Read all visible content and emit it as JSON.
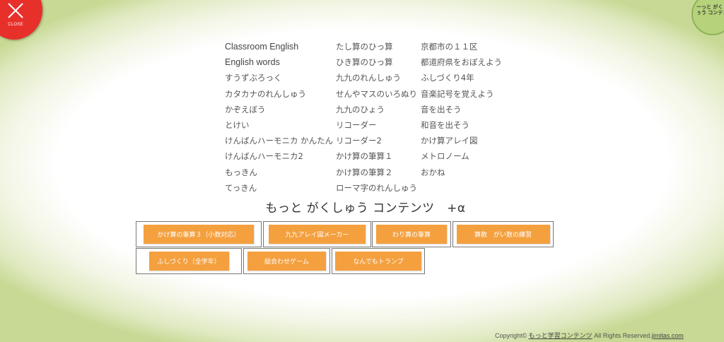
{
  "close": {
    "label": "CLOSE"
  },
  "logo": {
    "text": "ーっと がく　ぅう コンテン"
  },
  "links": {
    "col1": [
      "Classroom English",
      "English words",
      "すうずぶろっく",
      "カタカナのれんしゅう",
      "かぞえぼう",
      "とけい",
      "けんばんハーモニカ かんたん",
      "けんばんハーモニカ2",
      "もっきん",
      "てっきん"
    ],
    "col2": [
      "たし算のひっ算",
      "ひき算のひっ算",
      "九九のれんしゅう",
      "せんやマスのいろぬり",
      "九九のひょう",
      "リコーダー",
      "リコーダー2",
      "かけ算の筆算１",
      "かけ算の筆算２",
      "ローマ字のれんしゅう"
    ],
    "col3": [
      "京都市の１１区",
      "都道府県をおぼえよう",
      "ふしづくり4年",
      "音楽記号を覚えよう",
      "音を出そう",
      "和音を出そう",
      "かけ算アレイ図",
      "メトロノーム",
      "おかね"
    ]
  },
  "heading": "もっと がくしゅう コンテンツ　+α",
  "tools": {
    "row1": [
      "かけ算の筆算３（小数対応）",
      "九九アレイ図メーカー",
      "わり算の筆算",
      "算数　がい数の練習"
    ],
    "row2": [
      "ふしづくり（全学年）",
      "総合わせゲーム",
      "なんでもトランプ"
    ]
  },
  "footer": {
    "prefix": "Copyright©",
    "link": "もっと学習コンテンツ",
    "suffix": "All Rights Reserved.",
    "site": "jimitas.com"
  }
}
